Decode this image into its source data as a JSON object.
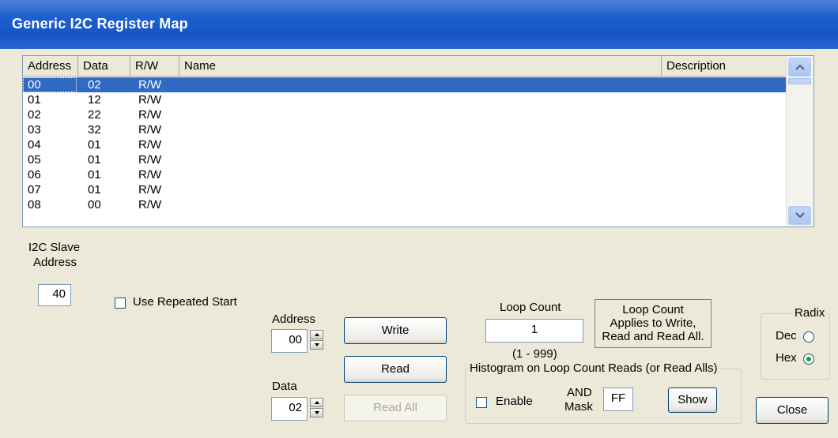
{
  "window": {
    "title": "Generic I2C Register Map"
  },
  "colors": {
    "titlebar": "#1e5fcf",
    "selection": "#316ac5",
    "face": "#ece9d8"
  },
  "list": {
    "columns": [
      "Address",
      "Data",
      "R/W",
      "Name",
      "Description"
    ],
    "rows": [
      {
        "address": "00",
        "data": "02",
        "rw": "R/W",
        "name": "",
        "description": ""
      },
      {
        "address": "01",
        "data": "12",
        "rw": "R/W",
        "name": "",
        "description": ""
      },
      {
        "address": "02",
        "data": "22",
        "rw": "R/W",
        "name": "",
        "description": ""
      },
      {
        "address": "03",
        "data": "32",
        "rw": "R/W",
        "name": "",
        "description": ""
      },
      {
        "address": "04",
        "data": "01",
        "rw": "R/W",
        "name": "",
        "description": ""
      },
      {
        "address": "05",
        "data": "01",
        "rw": "R/W",
        "name": "",
        "description": ""
      },
      {
        "address": "06",
        "data": "01",
        "rw": "R/W",
        "name": "",
        "description": ""
      },
      {
        "address": "07",
        "data": "01",
        "rw": "R/W",
        "name": "",
        "description": ""
      },
      {
        "address": "08",
        "data": "00",
        "rw": "R/W",
        "name": "",
        "description": ""
      }
    ],
    "selected_index": 0
  },
  "slave": {
    "label_line1": "I2C Slave",
    "label_line2": "Address",
    "value": "40"
  },
  "repeated_start": {
    "label": "Use Repeated Start",
    "checked": false
  },
  "address": {
    "label": "Address",
    "value": "00"
  },
  "data": {
    "label": "Data",
    "value": "02"
  },
  "buttons": {
    "write": "Write",
    "read": "Read",
    "read_all": "Read All",
    "show": "Show",
    "close": "Close"
  },
  "loop": {
    "label": "Loop Count",
    "value": "1",
    "range": "(1 - 999)",
    "note_line1": "Loop Count",
    "note_line2": "Applies to Write,",
    "note_line3": "Read and Read All."
  },
  "histogram": {
    "label": "Histogram on Loop Count Reads (or Read Alls)",
    "enable_label": "Enable",
    "enable_checked": false,
    "and_label": "AND",
    "mask_label": "Mask",
    "mask_value": "FF"
  },
  "radix": {
    "label": "Radix",
    "dec_label": "Dec",
    "hex_label": "Hex",
    "selected": "Hex"
  }
}
